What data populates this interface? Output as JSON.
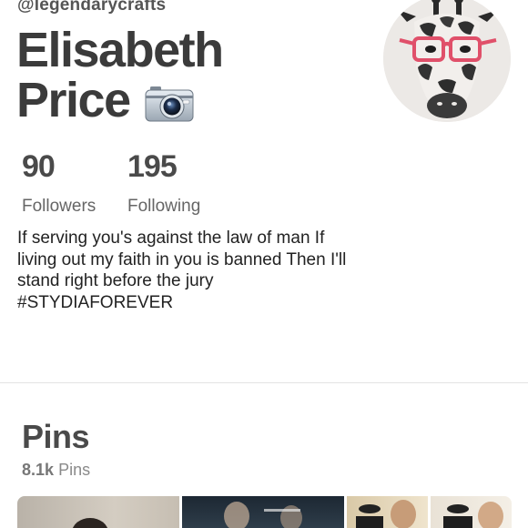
{
  "profile": {
    "handle": "@legendarycrafts",
    "name_line1": "Elisabeth",
    "name_line2": "Price"
  },
  "stats": {
    "followers_count": "90",
    "followers_label": "Followers",
    "following_count": "195",
    "following_label": "Following"
  },
  "bio": "If serving you's against the law of man If living out my faith in you is banned Then I'll stand right before the jury #STYDIAFOREVER",
  "pins": {
    "title": "Pins",
    "count": "8.1k",
    "count_label": "Pins"
  },
  "icons": {
    "name_emoji": "camera-icon",
    "avatar": "giraffe-with-glasses"
  },
  "colors": {
    "glasses": "#e0506a",
    "name_text": "#3b3b3b"
  }
}
